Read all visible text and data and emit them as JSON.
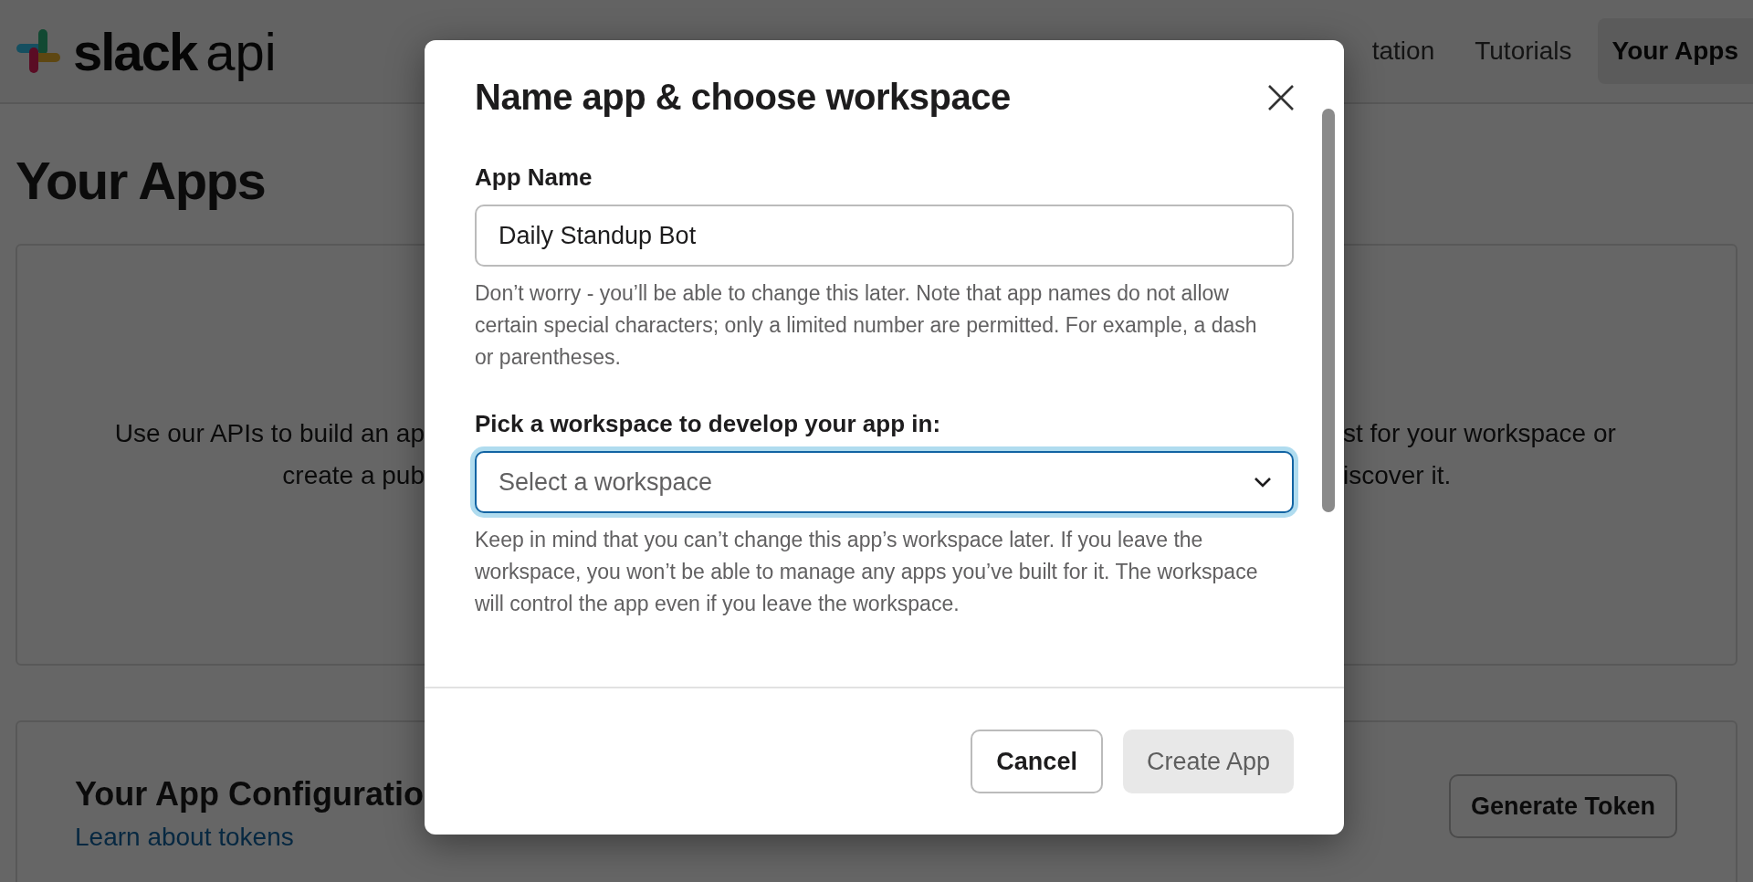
{
  "header": {
    "logo": {
      "word": "slack",
      "suffix": "api"
    },
    "nav": [
      {
        "label": "tation",
        "selected": false
      },
      {
        "label": "Tutorials",
        "selected": false
      },
      {
        "label": "Your Apps",
        "selected": true
      }
    ]
  },
  "page": {
    "title": "Your Apps",
    "intro": {
      "left_lines": [
        "Use our APIs to build an ap",
        "create a pub"
      ],
      "right_lines": [
        "st for your workspace or",
        "iscover it."
      ]
    },
    "config": {
      "title": "Your App Configuratio",
      "link": "Learn about tokens",
      "button": "Generate Token"
    }
  },
  "dialog": {
    "title": "Name app & choose workspace",
    "fields": [
      {
        "label": "App Name",
        "kind": "text",
        "value": "Daily Standup Bot",
        "focused": false,
        "help": "Don’t worry - you’ll be able to change this later. Note that app names do not allow certain special characters; only a limited number are permitted. For example, a dash or parentheses."
      },
      {
        "label": "Pick a workspace to develop your app in:",
        "kind": "select",
        "placeholder": "Select a workspace",
        "focused": true,
        "help": "Keep in mind that you can’t change this app’s workspace later. If you leave the workspace, you won’t be able to manage any apps you’ve built for it. The workspace will control the app even if you leave the workspace."
      }
    ],
    "buttons": [
      {
        "label": "Cancel",
        "kind": "secondary",
        "disabled": false
      },
      {
        "label": "Create App",
        "kind": "primary",
        "disabled": true
      }
    ]
  }
}
